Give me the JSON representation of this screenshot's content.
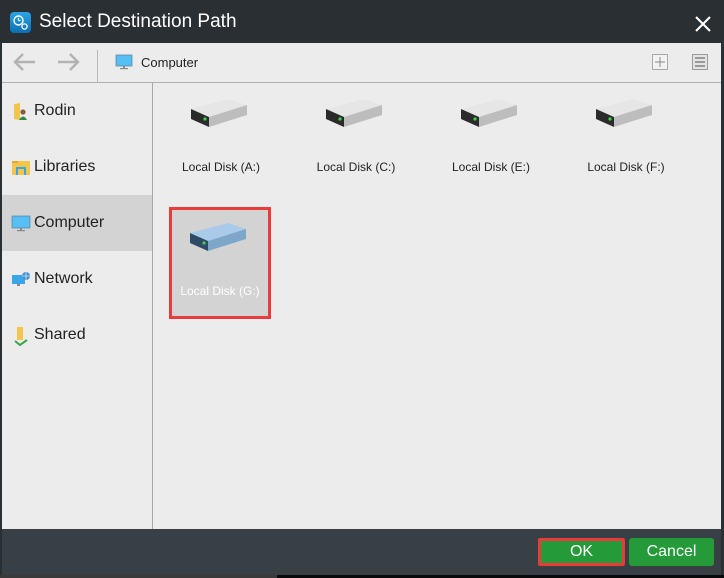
{
  "window": {
    "title": "Select Destination Path",
    "app_icon": "backup-clock-gear-icon",
    "close_icon": "close-icon"
  },
  "toolbar": {
    "back_icon": "arrow-left-icon",
    "forward_icon": "arrow-right-icon",
    "breadcrumb": {
      "icon": "computer-monitor-icon",
      "label": "Computer"
    },
    "new_folder_icon": "plus-icon",
    "view_icon": "list-view-icon"
  },
  "sidebar": {
    "items": [
      {
        "label": "Rodin",
        "icon": "user-folder-icon",
        "selected": false
      },
      {
        "label": "Libraries",
        "icon": "libraries-icon",
        "selected": false
      },
      {
        "label": "Computer",
        "icon": "computer-monitor-icon",
        "selected": true
      },
      {
        "label": "Network",
        "icon": "network-icon",
        "selected": false
      },
      {
        "label": "Shared",
        "icon": "shared-folder-icon",
        "selected": false
      }
    ]
  },
  "drives": [
    {
      "label": "Local Disk (A:)",
      "selected": false
    },
    {
      "label": "Local Disk (C:)",
      "selected": false
    },
    {
      "label": "Local Disk (E:)",
      "selected": false
    },
    {
      "label": "Local Disk (F:)",
      "selected": false
    },
    {
      "label": "Local Disk (G:)",
      "selected": true
    }
  ],
  "footer": {
    "ok_label": "OK",
    "cancel_label": "Cancel"
  },
  "colors": {
    "titlebar": "#2a2f33",
    "footer": "#394045",
    "button_green": "#249a38",
    "highlight_red": "#ea3a3a",
    "selected_bg": "#d3d3d3",
    "panel_bg": "#ececec"
  }
}
